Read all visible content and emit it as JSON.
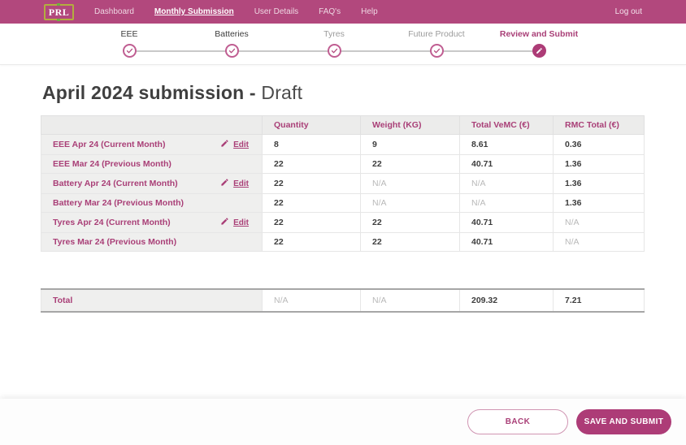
{
  "brand": {
    "logo_text": "PRL"
  },
  "nav": {
    "items": [
      {
        "label": "Dashboard",
        "active": false
      },
      {
        "label": "Monthly Submission",
        "active": true
      },
      {
        "label": "User Details",
        "active": false
      },
      {
        "label": "FAQ's",
        "active": false
      },
      {
        "label": "Help",
        "active": false
      }
    ],
    "logout_label": "Log out"
  },
  "stepper": {
    "steps": [
      {
        "label": "EEE",
        "state": "done",
        "muted": false
      },
      {
        "label": "Batteries",
        "state": "done",
        "muted": false
      },
      {
        "label": "Tyres",
        "state": "done",
        "muted": true
      },
      {
        "label": "Future Product",
        "state": "done",
        "muted": true
      },
      {
        "label": "Review and Submit",
        "state": "active",
        "muted": false
      }
    ]
  },
  "page": {
    "title_main": "April 2024 submission -",
    "title_status": "Draft"
  },
  "table": {
    "columns": [
      "",
      "Quantity",
      "Weight (KG)",
      "Total VeMC (€)",
      "RMC Total (€)"
    ],
    "edit_label": "Edit",
    "rows": [
      {
        "label": "EEE Apr 24 (Current Month)",
        "edit": true,
        "quantity": "8",
        "weight": "9",
        "vemc": "8.61",
        "rmc": "0.36"
      },
      {
        "label": "EEE Mar 24 (Previous Month)",
        "edit": false,
        "quantity": "22",
        "weight": "22",
        "vemc": "40.71",
        "rmc": "1.36"
      },
      {
        "label": "Battery Apr 24 (Current Month)",
        "edit": true,
        "quantity": "22",
        "weight": "N/A",
        "vemc": "N/A",
        "rmc": "1.36"
      },
      {
        "label": "Battery  Mar 24 (Previous Month)",
        "edit": false,
        "quantity": "22",
        "weight": "N/A",
        "vemc": "N/A",
        "rmc": "1.36"
      },
      {
        "label": "Tyres Apr 24 (Current Month)",
        "edit": true,
        "quantity": "22",
        "weight": "22",
        "vemc": "40.71",
        "rmc": "N/A"
      },
      {
        "label": "Tyres Mar 24 (Previous Month)",
        "edit": false,
        "quantity": "22",
        "weight": "22",
        "vemc": "40.71",
        "rmc": "N/A"
      }
    ],
    "total": {
      "label": "Total",
      "quantity": "N/A",
      "weight": "N/A",
      "vemc": "209.32",
      "rmc": "7.21"
    }
  },
  "footer": {
    "back_label": "BACK",
    "submit_label": "SAVE AND SUBMIT"
  },
  "icons": {
    "done_step": "check-icon",
    "active_step": "pencil-icon",
    "edit_row": "pencil-icon"
  },
  "colors": {
    "topbar_magenta": "#b2487d",
    "accent_magenta": "#a93f77",
    "logo_border_olive": "#b3ad3f",
    "na_gray": "#b9b9b9"
  }
}
